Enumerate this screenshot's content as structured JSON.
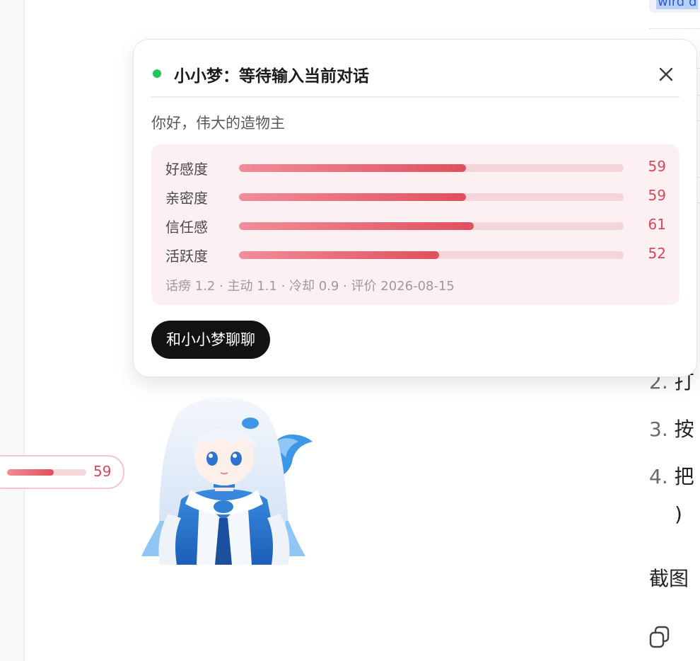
{
  "companion": {
    "name_status": "小小梦：等待输入当前对话",
    "status_color": "#22c55e",
    "greeting": "你好，伟大的造物主",
    "stats": [
      {
        "label": "好感度",
        "value": "59",
        "level": 0.59
      },
      {
        "label": "亲密度",
        "value": "59",
        "level": 0.59
      },
      {
        "label": "信任感",
        "value": "61",
        "level": 0.61
      },
      {
        "label": "活跃度",
        "value": "52",
        "level": 0.52
      }
    ],
    "meta": "话痨 1.2 · 主动 1.1 · 冷却 0.9 · 评价 2026-08-15",
    "chat_button": "和小小梦聊聊"
  },
  "mini_pill": {
    "value": "59",
    "level": 0.59
  },
  "background_doc": {
    "chip_text": "wird d",
    "list": [
      {
        "num": "2.",
        "text": "打"
      },
      {
        "num": "3.",
        "text": "按"
      },
      {
        "num": "4.",
        "text": "把"
      }
    ],
    "paren": ")",
    "caption": "截图"
  },
  "colors": {
    "accent_red": "#d9485a",
    "bar_start": "#f28c99",
    "bar_end": "#e0505e",
    "button_bg": "#111214"
  },
  "icons": {
    "close": "close-icon",
    "copy": "copy-icon",
    "status": "status-dot-icon",
    "avatar": "avatar-character"
  }
}
